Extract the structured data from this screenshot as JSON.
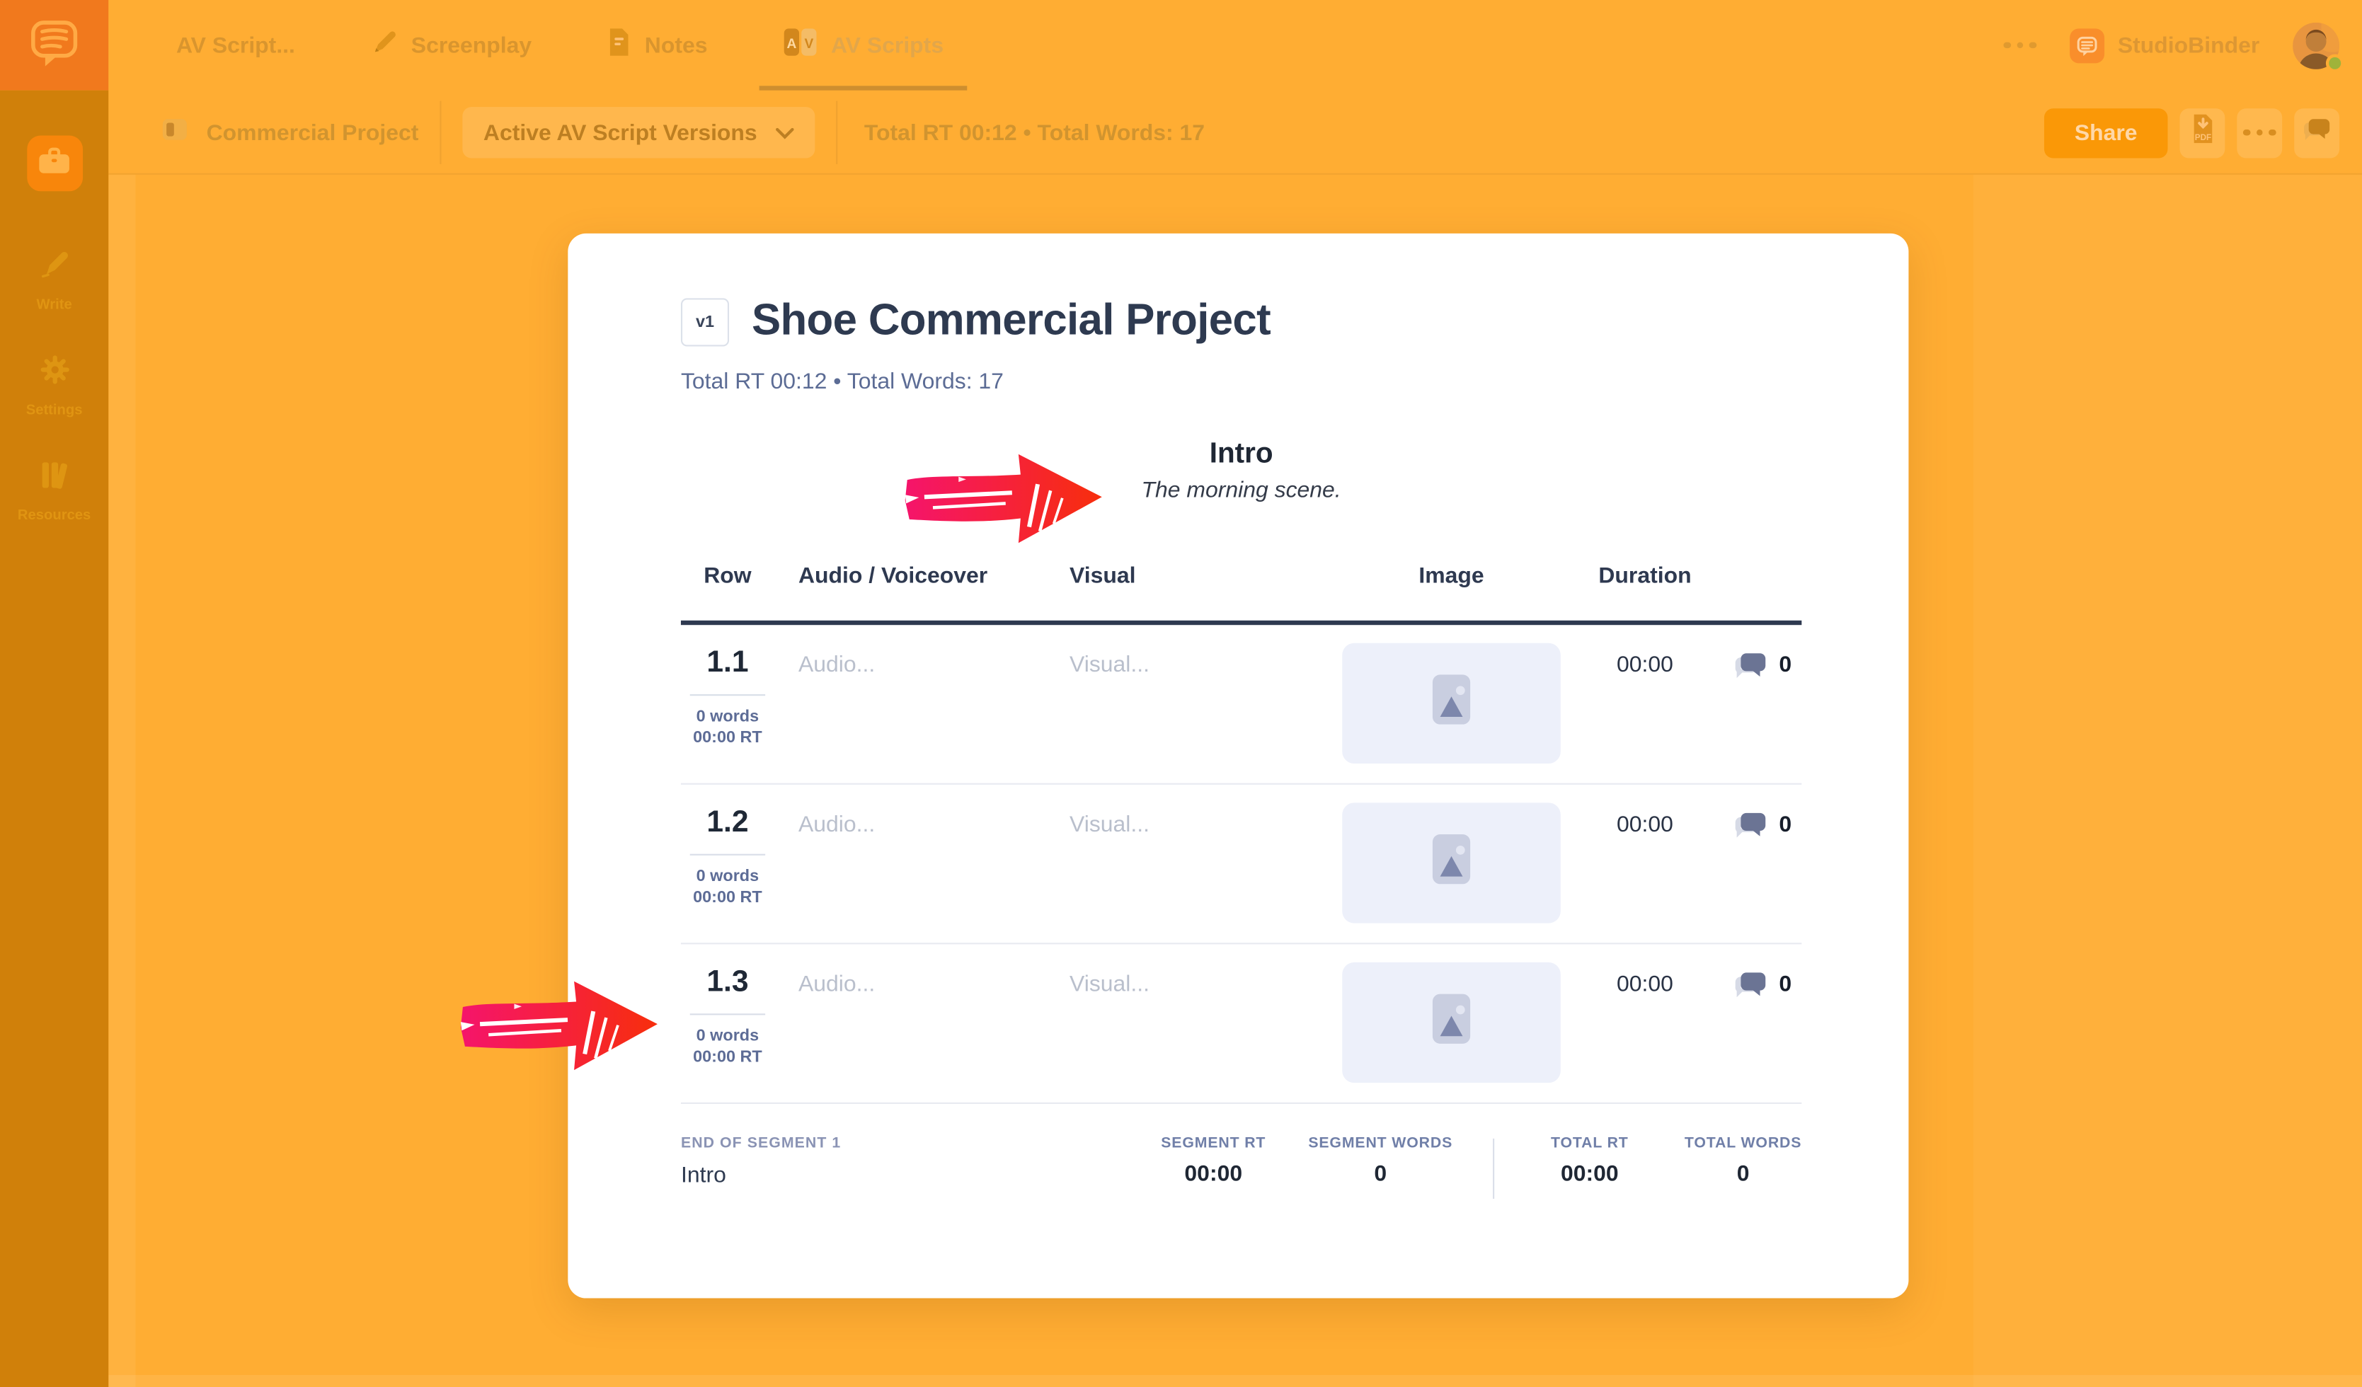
{
  "app": {
    "brand": "StudioBinder"
  },
  "topnav": {
    "tabs": [
      "AV Script...",
      "Screenplay",
      "Notes",
      "AV Scripts"
    ],
    "active_tab": "AV Scripts"
  },
  "toolbar": {
    "project": "Commercial Project",
    "versions_label": "Active AV Script Versions",
    "summary": "Total RT 00:12 • Total Words: 17",
    "share_label": "Share"
  },
  "sidebar": {
    "items": [
      "Write",
      "Settings",
      "Resources"
    ]
  },
  "document": {
    "version_badge": "v1",
    "title": "Shoe Commercial Project",
    "summary": "Total RT 00:12 • Total Words: 17",
    "segment": {
      "title": "Intro",
      "description": "The morning scene."
    }
  },
  "table": {
    "headers": [
      "Row",
      "Audio / Voiceover",
      "Visual",
      "Image",
      "Duration"
    ],
    "rows": [
      {
        "number": "1.1",
        "words": "0 words",
        "rt": "00:00 RT",
        "audio": "Audio...",
        "visual": "Visual...",
        "duration": "00:00",
        "comments": "0"
      },
      {
        "number": "1.2",
        "words": "0 words",
        "rt": "00:00 RT",
        "audio": "Audio...",
        "visual": "Visual...",
        "duration": "00:00",
        "comments": "0"
      },
      {
        "number": "1.3",
        "words": "0 words",
        "rt": "00:00 RT",
        "audio": "Audio...",
        "visual": "Visual...",
        "duration": "00:00",
        "comments": "0"
      }
    ]
  },
  "segment_footer": {
    "end_label": "END OF SEGMENT 1",
    "name": "Intro",
    "stats": [
      {
        "label": "SEGMENT RT",
        "value": "00:00"
      },
      {
        "label": "SEGMENT WORDS",
        "value": "0"
      },
      {
        "label": "TOTAL RT",
        "value": "00:00"
      },
      {
        "label": "TOTAL WORDS",
        "value": "0"
      }
    ]
  },
  "icons": {
    "logo": "speech-bubble-with-lines",
    "screenplay": "pencil",
    "notes": "document",
    "av_scripts": "av-blocks",
    "project": "panel",
    "versions": "chevron-down",
    "export": "pdf-download",
    "more": "three-dots",
    "comments": "chat-bubbles",
    "image_cell": "photo-placeholder",
    "annotation": "red-marker-arrow"
  },
  "colors": {
    "overlay": "#FFAD33",
    "sidebar": "#D0800A",
    "logo_square": "#F1791D",
    "share_button": "#FA9807",
    "card": "#FFFFFF",
    "ink": "#2E3A50",
    "muted_blue": "#5C6C95",
    "arrow_gradient_start": "#F5146B",
    "arrow_gradient_end": "#F72E0C",
    "status_dot": "#9FB33A"
  }
}
